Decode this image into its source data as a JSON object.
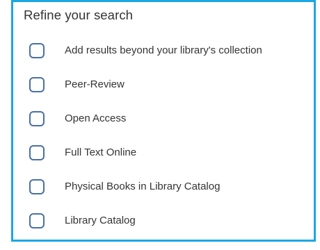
{
  "panel": {
    "title": "Refine your search",
    "accent_color": "#1aa7e4",
    "checkbox_color": "#4a6fa5",
    "options": [
      {
        "label": "Add results beyond your library's collection",
        "checked": false
      },
      {
        "label": "Peer-Review",
        "checked": false
      },
      {
        "label": "Open Access",
        "checked": false
      },
      {
        "label": "Full Text Online",
        "checked": false
      },
      {
        "label": "Physical Books in Library Catalog",
        "checked": false
      },
      {
        "label": "Library Catalog",
        "checked": false
      }
    ]
  }
}
